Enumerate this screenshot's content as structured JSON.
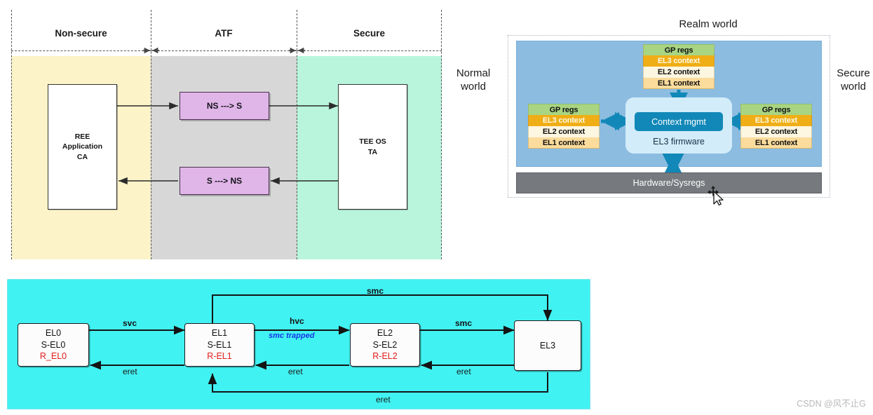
{
  "figure_atf": {
    "columns": [
      {
        "label": "Non-secure",
        "fill": "#fcf3c8"
      },
      {
        "label": "ATF",
        "fill": "#d7d7d7"
      },
      {
        "label": "Secure",
        "fill": "#b9f5dd"
      }
    ],
    "boxes": {
      "ree": "REE\nApplication\nCA",
      "ree_line1": "REE",
      "ree_line2": "Application",
      "ree_line3": "CA",
      "tee_line1": "TEE OS",
      "tee_line2": "TA",
      "ns_to_s": "NS ---> S",
      "s_to_ns": "S ---> NS"
    }
  },
  "figure_el3": {
    "realm_world": "Realm world",
    "normal_world_line1": "Normal",
    "normal_world_line2": "world",
    "secure_world_line1": "Secure",
    "secure_world_line2": "world",
    "context_mgmt": "Context mgmt",
    "el3_firmware": "EL3 firmware",
    "hardware": "Hardware/Sysregs",
    "stack_rows": [
      "GP regs",
      "EL3 context",
      "EL2 context",
      "EL1 context"
    ],
    "stacks": [
      {
        "name": "normal-world-context-stack",
        "rows": [
          "GP regs",
          "EL3 context",
          "EL2 context",
          "EL1 context"
        ]
      },
      {
        "name": "realm-world-context-stack",
        "rows": [
          "GP regs",
          "EL3 context",
          "EL2 context",
          "EL1 context"
        ]
      },
      {
        "name": "secure-world-context-stack",
        "rows": [
          "GP regs",
          "EL3 context",
          "EL2 context",
          "EL1 context"
        ]
      }
    ],
    "colors": {
      "gp_regs": "#a9d582",
      "el3_context": "#f0ae16",
      "el2_context": "#fdf6e0",
      "el1_context": "#fbdc9c",
      "panel_blue": "#8cbce0",
      "firmware_blue": "#d3ecfa",
      "accent_blue": "#1288b8",
      "hardware_grey": "#76797e"
    }
  },
  "figure_el_transitions": {
    "background": "#41f2f2",
    "nodes": [
      {
        "id": "el0",
        "lines": [
          "EL0",
          "S-EL0",
          "R_EL0"
        ]
      },
      {
        "id": "el1",
        "lines": [
          "EL1",
          "S-EL1",
          "R-EL1"
        ]
      },
      {
        "id": "el2",
        "lines": [
          "EL2",
          "S-EL2",
          "R-EL2"
        ]
      },
      {
        "id": "el3",
        "lines": [
          "EL3"
        ]
      }
    ],
    "edges": {
      "svc": "svc",
      "hvc": "hvc",
      "smc_trapped": "smc trapped",
      "smc_el2_el3": "smc",
      "smc_el1_el3": "smc",
      "eret_el1_el0": "eret",
      "eret_el2_el1": "eret",
      "eret_el3_el2": "eret",
      "eret_el3_el1": "eret"
    },
    "red_text_color": "#e01b1b",
    "trapped_text_color": "#1836e8"
  },
  "watermark": {
    "text": "CSDN @风不止G"
  }
}
